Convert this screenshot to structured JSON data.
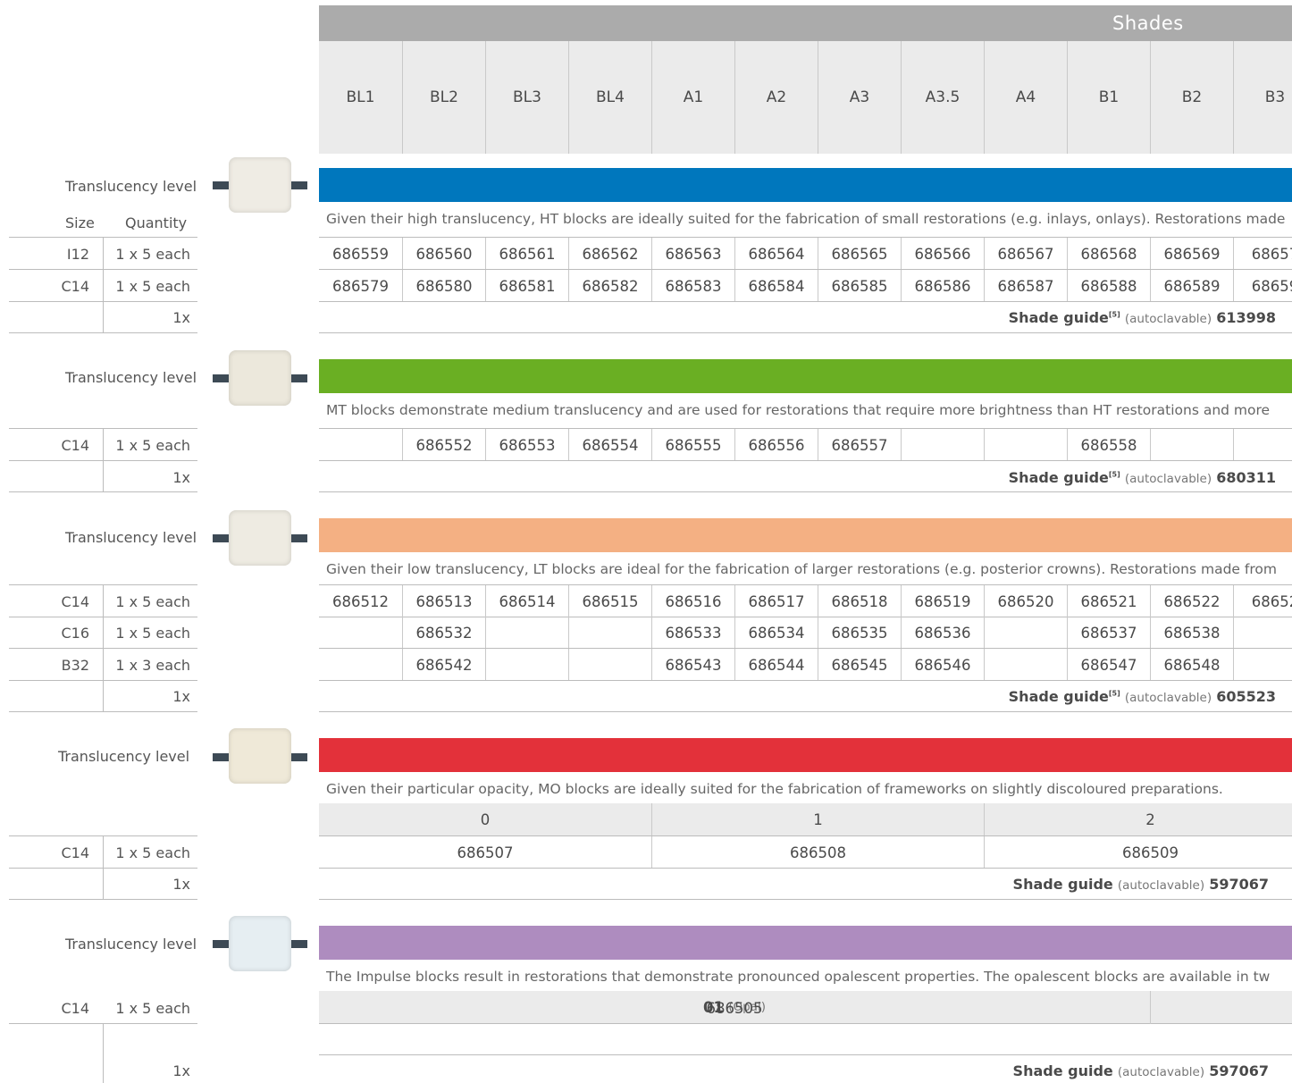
{
  "header": {
    "title": "Shades",
    "shades": [
      "BL1",
      "BL2",
      "BL3",
      "BL4",
      "A1",
      "A2",
      "A3",
      "A3.5",
      "A4",
      "B1",
      "B2",
      "B3"
    ]
  },
  "left_columns": {
    "size": "Size",
    "quantity": "Quantity"
  },
  "sections": [
    {
      "translucency_label": "Translucency level",
      "color": "#0077bd",
      "block_color": "#efece4",
      "description": "Given their high translucency, HT blocks are ideally suited for the fabrication of small restorations (e.g. inlays, onlays). Restorations made",
      "rows": [
        {
          "size": "I12",
          "quantity": "1 x 5 each",
          "codes": [
            "686559",
            "686560",
            "686561",
            "686562",
            "686563",
            "686564",
            "686565",
            "686566",
            "686567",
            "686568",
            "686569",
            "68657"
          ]
        },
        {
          "size": "C14",
          "quantity": "1 x 5 each",
          "codes": [
            "686579",
            "686580",
            "686581",
            "686582",
            "686583",
            "686584",
            "686585",
            "686586",
            "686587",
            "686588",
            "686589",
            "68659"
          ]
        }
      ],
      "guide": {
        "quantity": "1x",
        "label": "Shade guide",
        "sup": "[5]",
        "note": "(autoclavable)",
        "code": "613998"
      }
    },
    {
      "translucency_label": "Translucency level",
      "color": "#6aaf23",
      "block_color": "#ece8dc",
      "description": "MT blocks demonstrate medium translucency and are used for restorations that require more brightness than HT restorations and more",
      "rows": [
        {
          "size": "C14",
          "quantity": "1 x 5 each",
          "codes": [
            "",
            "686552",
            "686553",
            "686554",
            "686555",
            "686556",
            "686557",
            "",
            "",
            "686558",
            "",
            ""
          ]
        }
      ],
      "guide": {
        "quantity": "1x",
        "label": "Shade guide",
        "sup": "[5]",
        "note": "(autoclavable)",
        "code": "680311"
      }
    },
    {
      "translucency_label": "Translucency level",
      "color": "#f4b083",
      "block_color": "#eeebe2",
      "description": "Given their low translucency, LT blocks are ideal for the fabrication of larger restorations (e.g. posterior crowns). Restorations made from",
      "rows": [
        {
          "size": "C14",
          "quantity": "1 x 5 each",
          "codes": [
            "686512",
            "686513",
            "686514",
            "686515",
            "686516",
            "686517",
            "686518",
            "686519",
            "686520",
            "686521",
            "686522",
            "68652"
          ]
        },
        {
          "size": "C16",
          "quantity": "1 x 5 each",
          "codes": [
            "",
            "686532",
            "",
            "",
            "686533",
            "686534",
            "686535",
            "686536",
            "",
            "686537",
            "686538",
            ""
          ]
        },
        {
          "size": "B32",
          "quantity": "1 x 3 each",
          "codes": [
            "",
            "686542",
            "",
            "",
            "686543",
            "686544",
            "686545",
            "686546",
            "",
            "686547",
            "686548",
            ""
          ]
        }
      ],
      "guide": {
        "quantity": "1x",
        "label": "Shade guide",
        "sup": "[5]",
        "note": "(autoclavable)",
        "code": "605523"
      }
    },
    {
      "translucency_label": "Translucency level",
      "color": "#e3313a",
      "block_color": "#efe9d8",
      "description": "Given their particular opacity, MO blocks are ideally suited for the fabrication of frameworks on slightly discoloured preparations.",
      "mo_headers": [
        "0",
        "1",
        "2"
      ],
      "rows": [
        {
          "size": "C14",
          "quantity": "1 x 5 each",
          "codes": [
            "686507",
            "686508",
            "686509"
          ]
        }
      ],
      "guide": {
        "quantity": "1x",
        "label": "Shade guide",
        "sup": "",
        "note": "(autoclavable)",
        "code": "597067"
      }
    },
    {
      "translucency_label": "Translucency level",
      "color": "#ae8cbf",
      "block_color": "#e6eef2",
      "description": "The Impulse blocks result in restorations that demonstrate pronounced opalescent properties. The opalescent blocks are available in tw",
      "impulse_header": {
        "code": "01",
        "note": "(Opal)"
      },
      "rows": [
        {
          "size": "C14",
          "quantity": "1 x 5 each",
          "codes": [
            "686505"
          ]
        }
      ],
      "guide": {
        "quantity": "1x",
        "label": "Shade guide",
        "sup": "",
        "note": "(autoclavable)",
        "code": "597067"
      }
    }
  ]
}
